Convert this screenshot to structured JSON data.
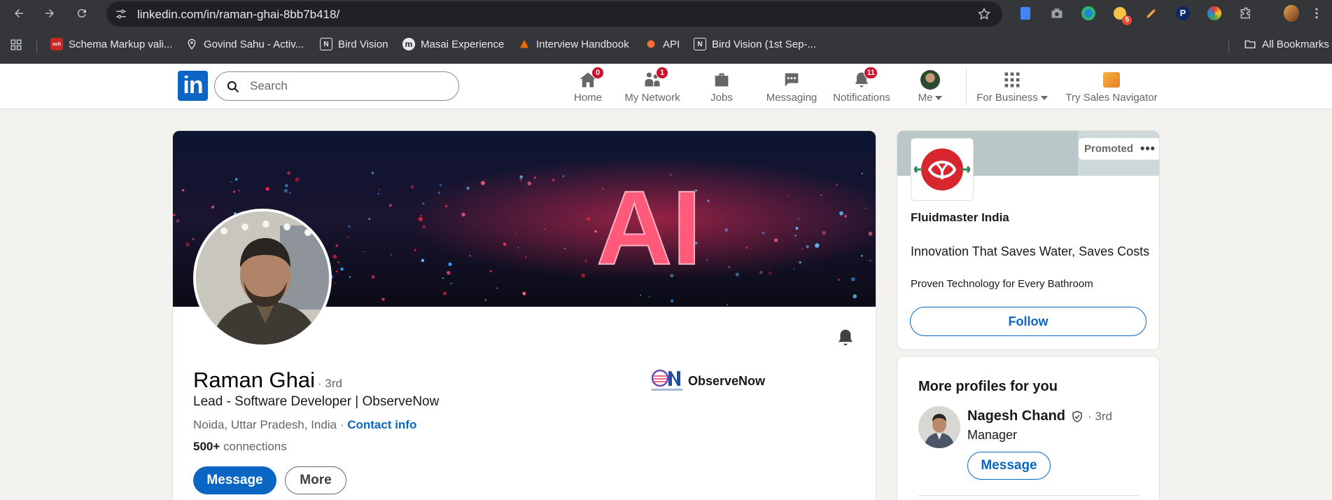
{
  "browser": {
    "url": "linkedin.com/in/raman-ghai-8bb7b418/",
    "bookmarks": [
      {
        "label": "Schema Markup vali...",
        "icon": "schema-icon"
      },
      {
        "label": "Govind Sahu - Activ...",
        "icon": "location-icon"
      },
      {
        "label": "Bird Vision",
        "icon": "notion-icon"
      },
      {
        "label": "Masai Experience",
        "icon": "masai-icon"
      },
      {
        "label": "Interview Handbook",
        "icon": "handbook-icon"
      },
      {
        "label": "API",
        "icon": "api-icon"
      },
      {
        "label": "Bird Vision (1st Sep-...",
        "icon": "notion-icon"
      }
    ],
    "all_bookmarks": "All Bookmarks",
    "extension_badge": "5"
  },
  "header": {
    "search_placeholder": "Search",
    "nav": [
      {
        "label": "Home",
        "badge": "0"
      },
      {
        "label": "My Network",
        "badge": "1"
      },
      {
        "label": "Jobs",
        "badge": ""
      },
      {
        "label": "Messaging",
        "badge": ""
      },
      {
        "label": "Notifications",
        "badge": "11"
      },
      {
        "label": "Me",
        "badge": ""
      }
    ],
    "for_business": "For Business",
    "sales_nav": "Try Sales Navigator"
  },
  "profile": {
    "name": "Raman Ghai",
    "degree": "· 3rd",
    "headline": "Lead - Software Developer | ObserveNow",
    "location": "Noida, Uttar Pradesh, India ·",
    "contact_info": "Contact info",
    "connections_count": "500+",
    "connections_label": "connections",
    "message_button": "Message",
    "more_button": "More",
    "company": "ObserveNow",
    "banner_text": "AI"
  },
  "ad": {
    "promoted": "Promoted",
    "company": "Fluidmaster India",
    "tagline": "Innovation That Saves Water, Saves Costs",
    "subtext": "Proven Technology for Every Bathroom",
    "follow_button": "Follow"
  },
  "more_profiles": {
    "title": "More profiles for you",
    "items": [
      {
        "name": "Nagesh Chand",
        "degree": "· 3rd",
        "role": "Manager",
        "button": "Message"
      }
    ]
  },
  "colors": {
    "brand": "#0a66c2",
    "badge": "#cb112d",
    "chrome_bg": "#35363a"
  }
}
